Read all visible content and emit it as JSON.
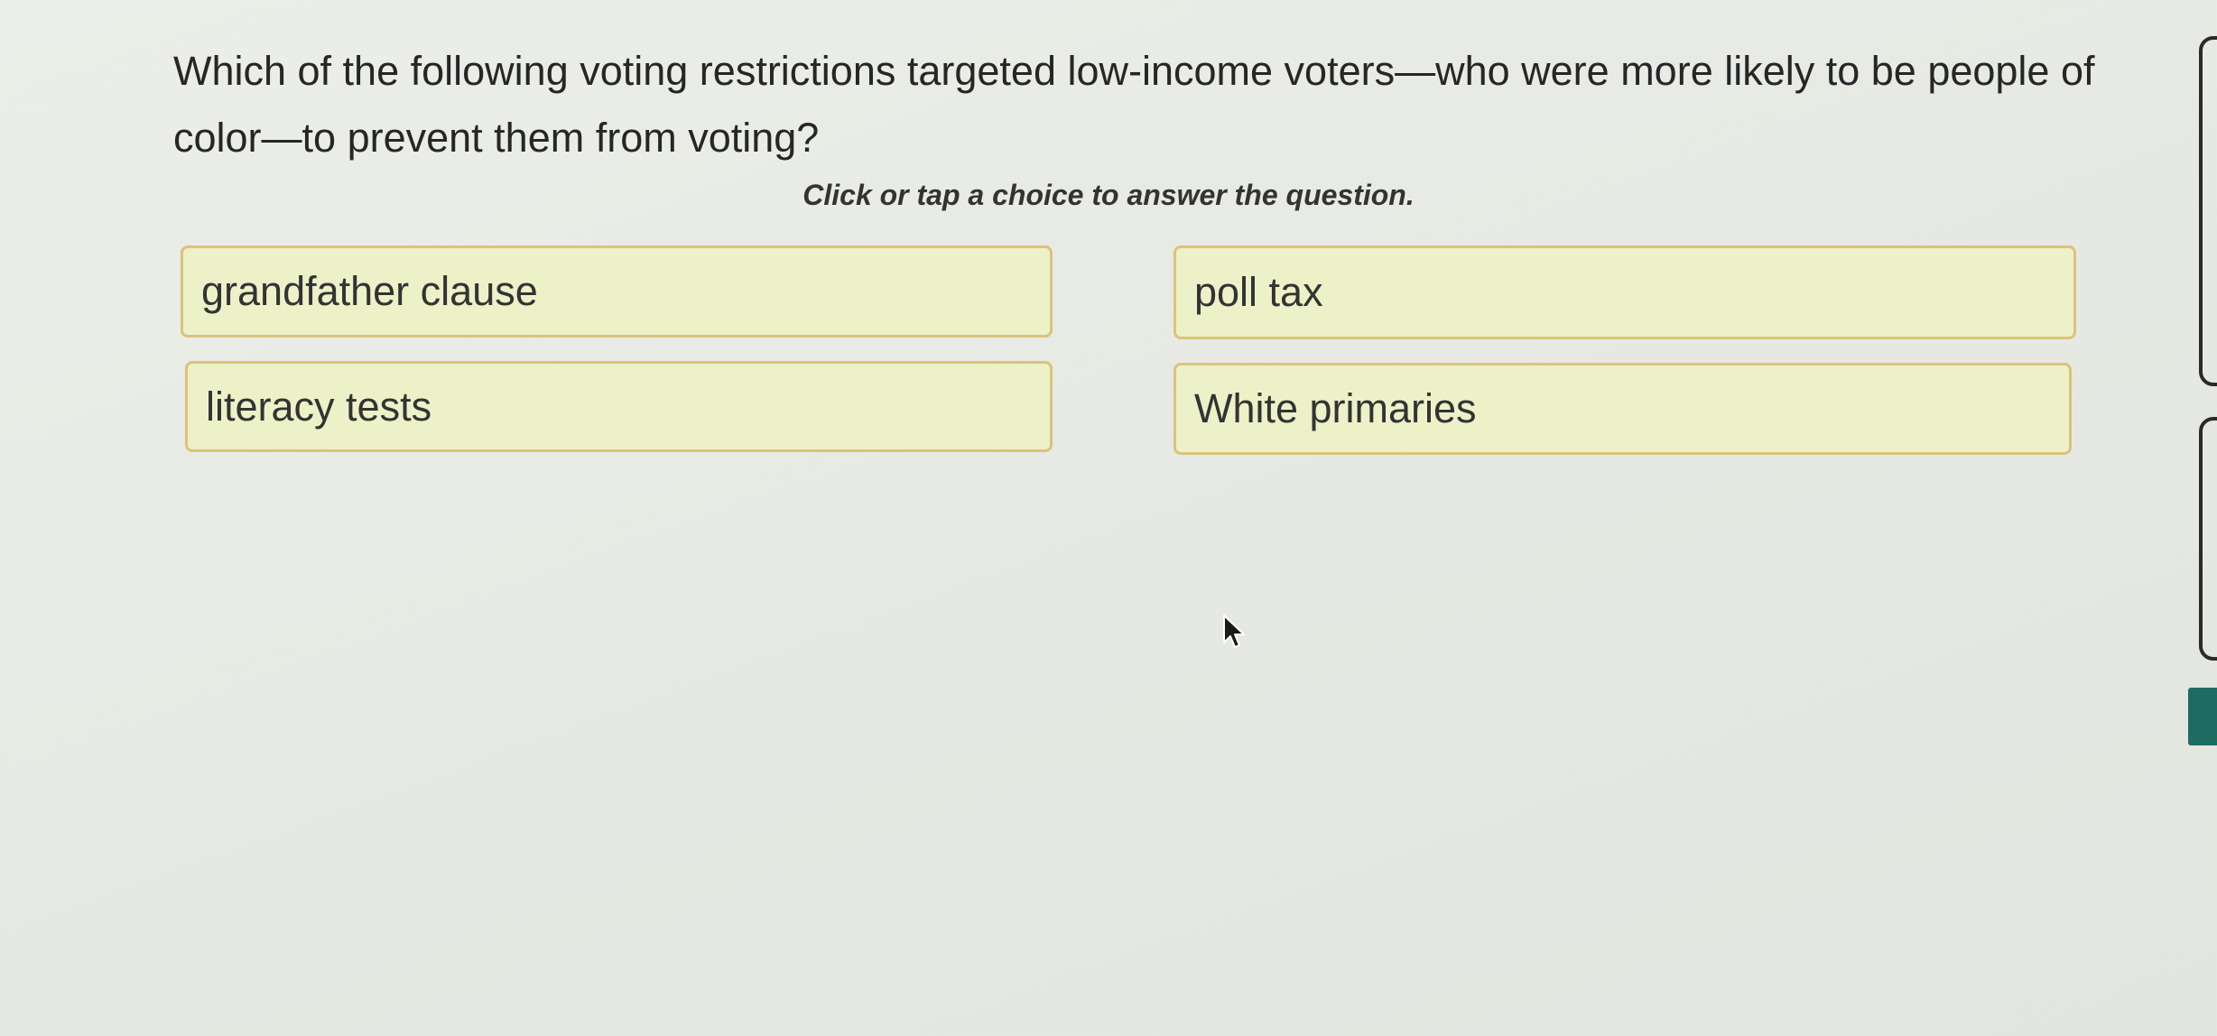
{
  "question": {
    "text": "Which of the following voting restrictions targeted low-income voters—who were more likely to be people of color—to prevent them from voting?"
  },
  "instruction": "Click or tap a choice to answer the question.",
  "choices": [
    {
      "label": "grandfather clause"
    },
    {
      "label": "poll tax"
    },
    {
      "label": "literacy tests"
    },
    {
      "label": "White primaries"
    }
  ],
  "colors": {
    "choice_background": "#ecf1c8",
    "choice_border": "#dcc37a",
    "side_tab": "#1e6b62",
    "page_background": "#e9ebe6"
  },
  "icons": {
    "cursor": "mouse-pointer-icon"
  }
}
